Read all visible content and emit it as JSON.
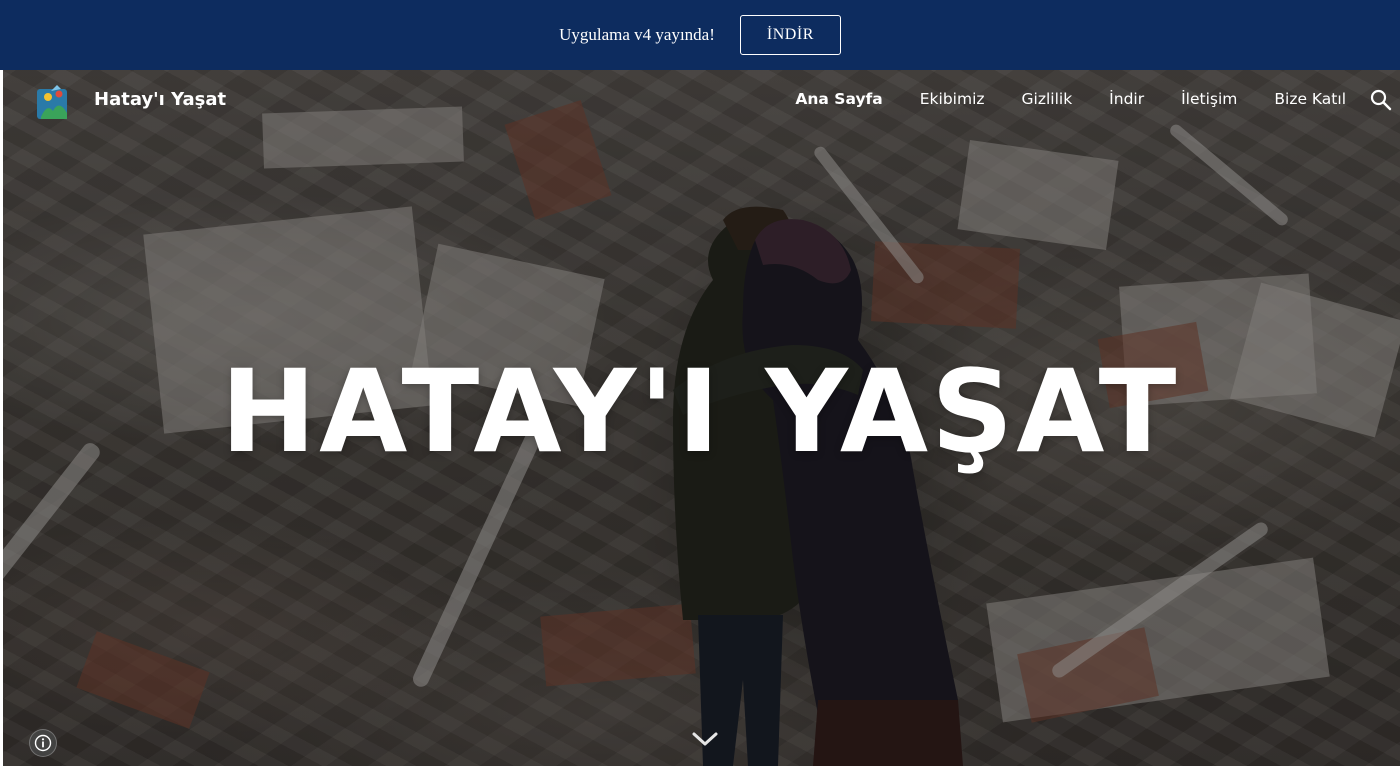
{
  "announcement": {
    "text": "Uygulama v4 yayında!",
    "button_label": "İNDİR"
  },
  "header": {
    "site_title": "Hatay'ı Yaşat",
    "logo_icon": "hatay-logo-icon",
    "nav": [
      {
        "label": "Ana Sayfa",
        "active": true
      },
      {
        "label": "Ekibimiz",
        "active": false
      },
      {
        "label": "Gizlilik",
        "active": false
      },
      {
        "label": "İndir",
        "active": false
      },
      {
        "label": "İletişim",
        "active": false
      },
      {
        "label": "Bize Katıl",
        "active": false
      }
    ],
    "search_icon": "search-icon"
  },
  "hero": {
    "title": "HATAY'I YAŞAT",
    "scroll_icon": "chevron-down-icon",
    "info_icon": "info-icon"
  },
  "colors": {
    "announcement_bg": "#0d2c5f",
    "text": "#ffffff"
  }
}
